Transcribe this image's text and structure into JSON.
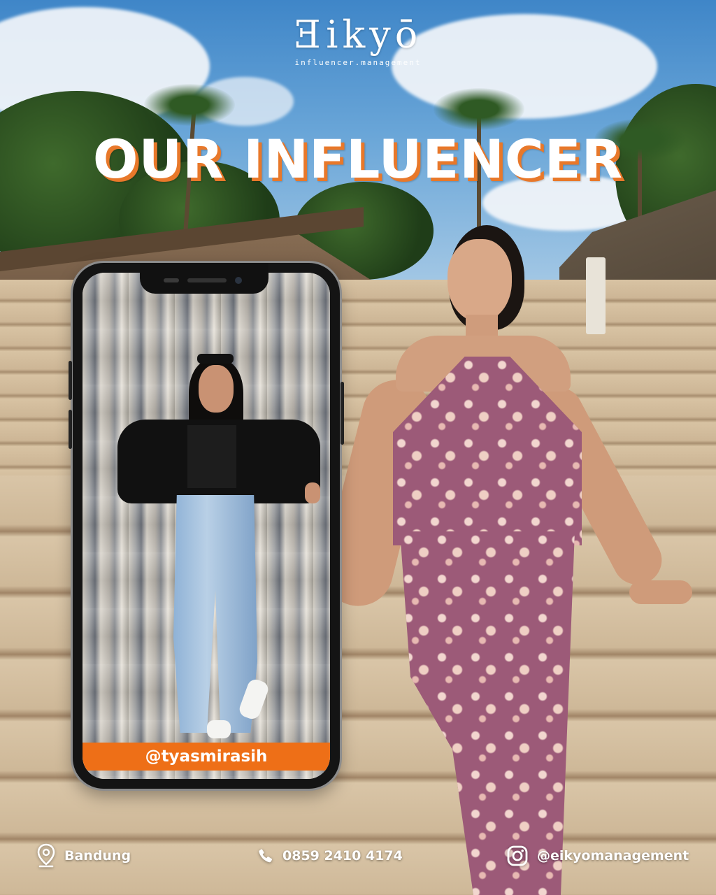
{
  "brand": {
    "logo_text": "Ǝikyō",
    "logo_subtitle": "influencer.management"
  },
  "headline": "OUR INFLUENCER",
  "phone_card": {
    "handle": "@tyasmirasih"
  },
  "footer": {
    "location": "Bandung",
    "phone": "0859 2410 4174",
    "instagram": "@eikyomanagement"
  },
  "icons": {
    "location": "map-pin-icon",
    "phone": "phone-icon",
    "instagram": "instagram-icon"
  },
  "colors": {
    "accent": "#ee6f17",
    "title_shadow": "#e8782a",
    "text": "#ffffff"
  }
}
